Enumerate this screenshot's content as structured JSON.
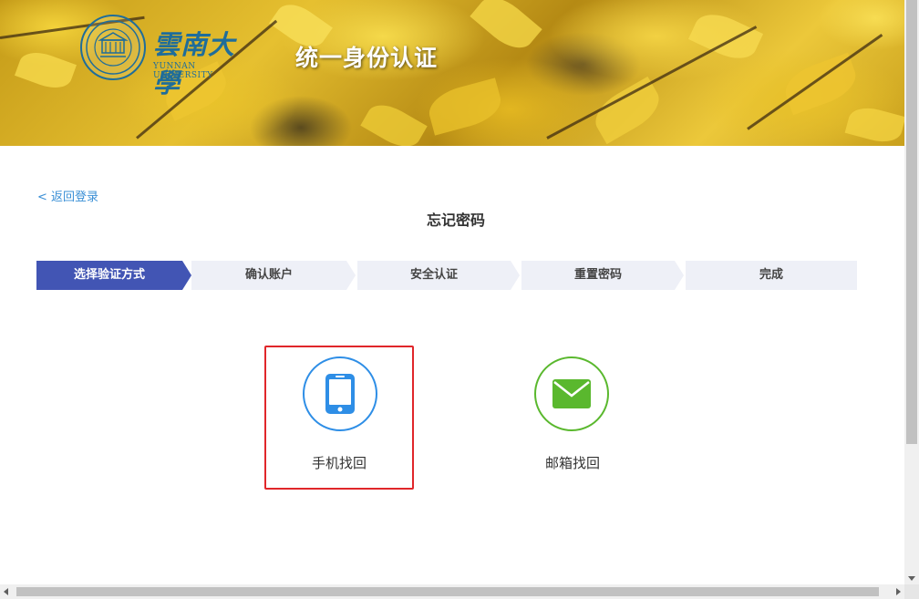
{
  "banner": {
    "logo_cn": "雲南大學",
    "logo_en": "YUNNAN UNIVERSITY",
    "logo_icon": "university-seal-icon",
    "title": "统一身份认证"
  },
  "nav": {
    "back_label": "< 返回登录"
  },
  "page": {
    "title": "忘记密码"
  },
  "steps": [
    {
      "label": "选择验证方式",
      "active": true
    },
    {
      "label": "确认账户",
      "active": false
    },
    {
      "label": "安全认证",
      "active": false
    },
    {
      "label": "重置密码",
      "active": false
    },
    {
      "label": "完成",
      "active": false
    }
  ],
  "options": [
    {
      "label": "手机找回",
      "icon": "phone-icon",
      "color": "#2e8ee6",
      "selected": true
    },
    {
      "label": "邮箱找回",
      "icon": "mail-icon",
      "color": "#5ab82e",
      "selected": false
    }
  ],
  "colors": {
    "step_active": "#4255b4",
    "step_inactive": "#eef0f7",
    "link": "#3a8fd6",
    "selection_border": "#e0262a"
  }
}
